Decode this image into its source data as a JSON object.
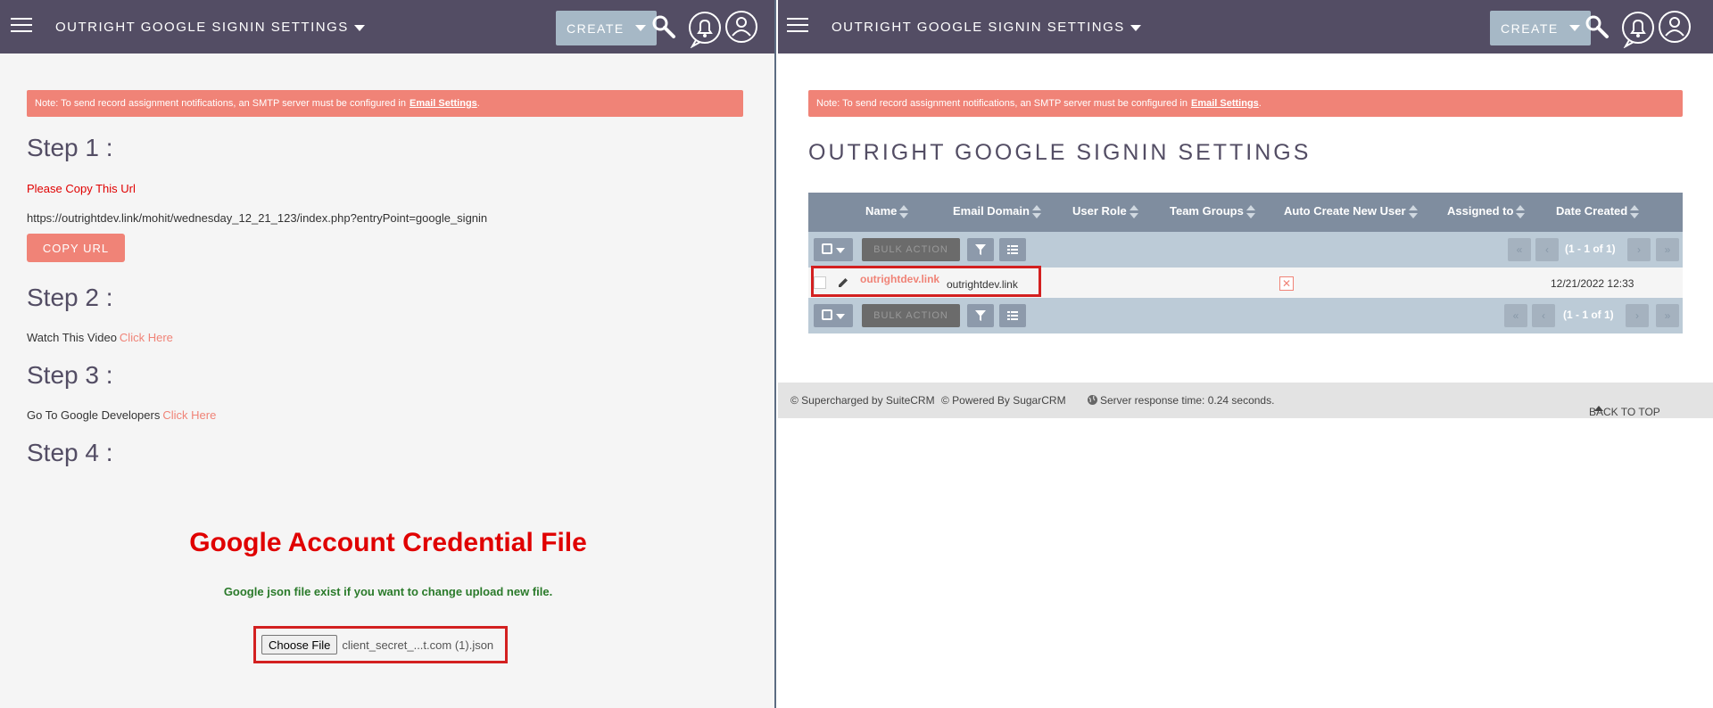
{
  "left": {
    "nav": {
      "module_title": "OUTRIGHT GOOGLE SIGNIN SETTINGS",
      "create_label": "CREATE"
    },
    "notice": {
      "text": "Note: To send record assignment notifications, an SMTP server must be configured in",
      "link": "Email Settings",
      "end": "."
    },
    "step1": {
      "heading": "Step 1 :",
      "instruction": "Please Copy This Url",
      "url": "https://outrightdev.link/mohit/wednesday_12_21_123/index.php?entryPoint=google_signin",
      "button": "COPY URL"
    },
    "step2": {
      "heading": "Step 2 :",
      "text": "Watch This Video",
      "link": "Click Here"
    },
    "step3": {
      "heading": "Step 3 :",
      "text": "Go To Google Developers",
      "link": "Click Here"
    },
    "step4": {
      "heading": "Step 4 :"
    },
    "credential": {
      "title": "Google Account Credential File",
      "subtitle": "Google json file exist if you want to change upload new file.",
      "choose_label": "Choose File",
      "file_name": "client_secret_...t.com (1).json"
    }
  },
  "right": {
    "nav": {
      "module_title": "OUTRIGHT GOOGLE SIGNIN SETTINGS",
      "create_label": "CREATE"
    },
    "notice": {
      "text": "Note: To send record assignment notifications, an SMTP server must be configured in",
      "link": "Email Settings",
      "end": "."
    },
    "page_title": "OUTRIGHT GOOGLE SIGNIN SETTINGS",
    "table": {
      "columns": [
        "Name",
        "Email Domain",
        "User Role",
        "Team Groups",
        "Auto Create New User",
        "Assigned to",
        "Date Created"
      ],
      "bulk_action": "BULK ACTION",
      "pagination": "(1 - 1 of 1)",
      "rows": [
        {
          "name": "outrightdev.link",
          "email_domain": "outrightdev.link",
          "auto_create_mark": "✕",
          "date_created": "12/21/2022 12:33"
        }
      ]
    },
    "footer": {
      "suitecrm": "© Supercharged by SuiteCRM",
      "sugarcrm": "© Powered By SugarCRM",
      "response": "Server response time: 0.24 seconds.",
      "back_to_top": "BACK TO TOP"
    }
  },
  "colors": {
    "navbar": "#534d64",
    "accent": "#f08377",
    "table_header": "#7f8d9f",
    "toolbar": "#bccbd7",
    "highlight": "#d32020",
    "credential_title": "#e00000",
    "success_text": "#2a7a2a"
  },
  "icons": [
    "hamburger-icon",
    "caret-down-icon",
    "search-icon",
    "bell-icon",
    "user-icon",
    "filter-icon",
    "columns-icon",
    "pencil-icon",
    "globe-icon",
    "sort-icon"
  ]
}
